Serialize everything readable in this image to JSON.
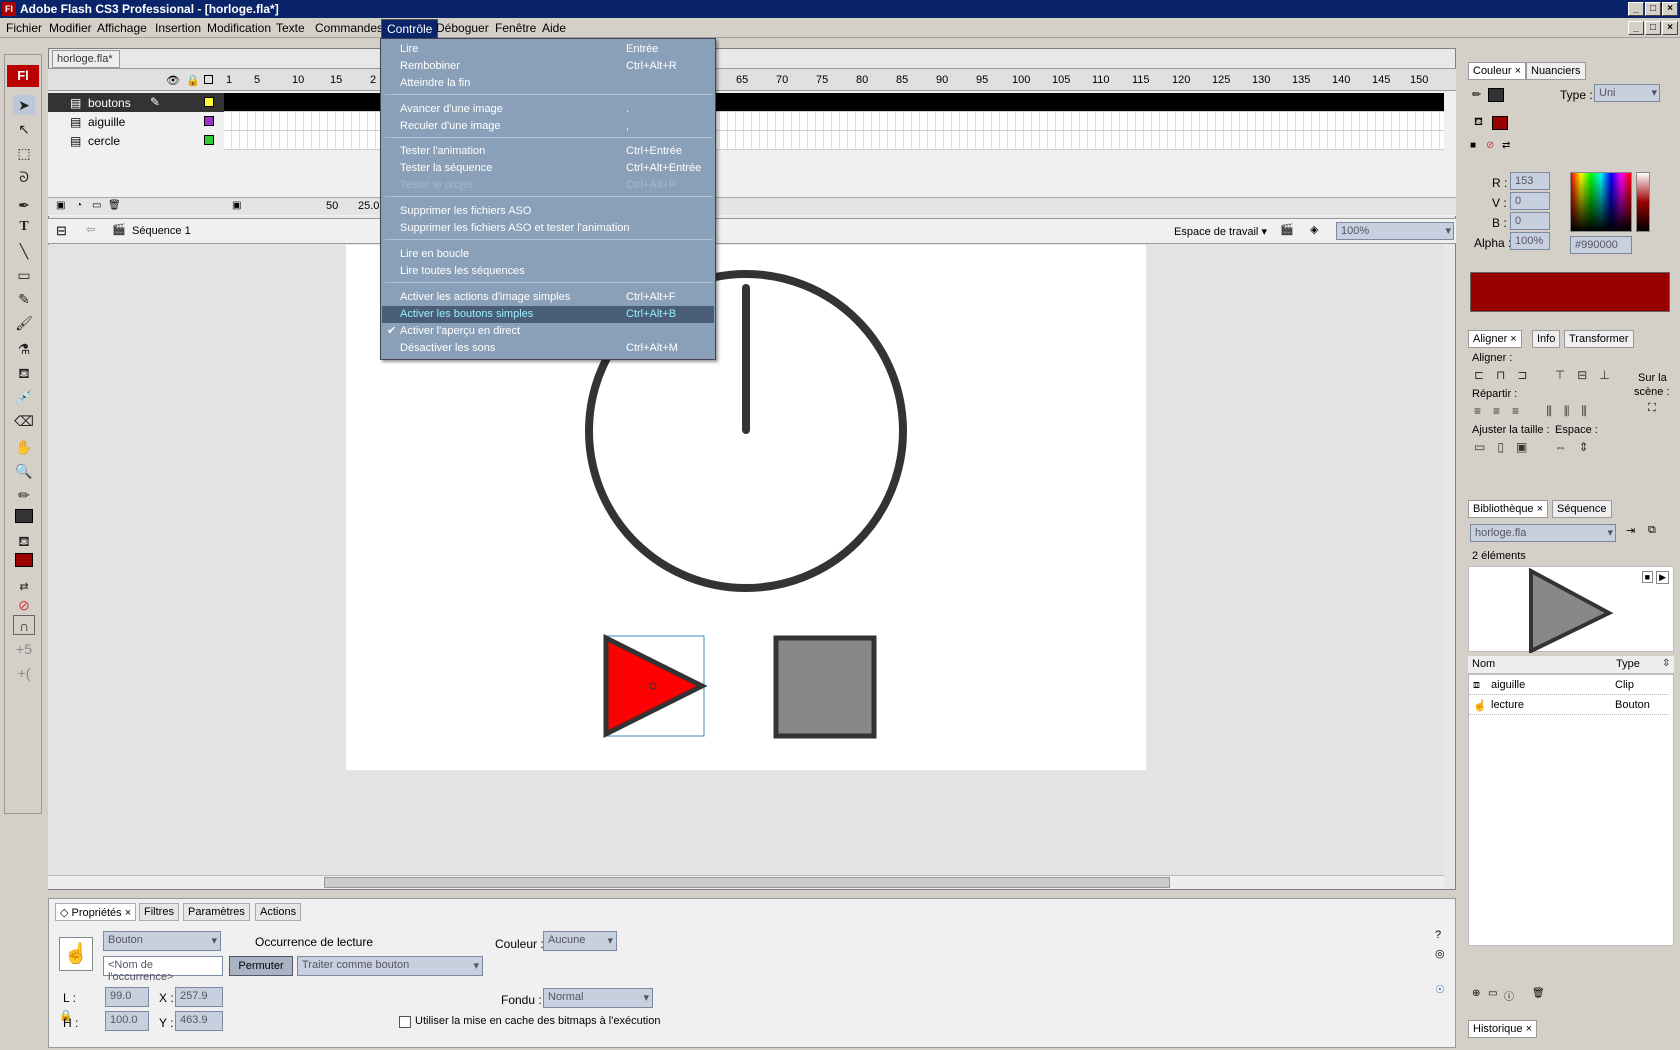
{
  "window": {
    "title": "Adobe Flash CS3 Professional - [horloge.fla*]",
    "logo": "Fl"
  },
  "menubar": [
    "Fichier",
    "Modifier",
    "Affichage",
    "Insertion",
    "Modification",
    "Texte",
    "Commandes",
    "Contrôle",
    "Déboguer",
    "Fenêtre",
    "Aide"
  ],
  "doc": {
    "tab": "horloge.fla*",
    "scene": "Séquence 1",
    "workspace": "Espace de travail",
    "zoom": "100%"
  },
  "timeline": {
    "ruler": [
      "1",
      "5",
      "10",
      "15",
      "2",
      "65",
      "70",
      "75",
      "80",
      "85",
      "90",
      "95",
      "100",
      "105",
      "110",
      "115",
      "120",
      "125",
      "130",
      "135",
      "140",
      "145",
      "150"
    ],
    "layers": [
      {
        "name": "boutons",
        "color": "#ffff33"
      },
      {
        "name": "aiguille",
        "color": "#9933cc"
      },
      {
        "name": "cercle",
        "color": "#33cc33"
      }
    ],
    "fps": "25.0",
    "frame": "50"
  },
  "menu": {
    "items": [
      {
        "label": "Lire",
        "shortcut": "Entrée"
      },
      {
        "label": "Rembobiner",
        "shortcut": "Ctrl+Alt+R"
      },
      {
        "label": "Atteindre la fin",
        "shortcut": ""
      },
      {
        "label": "Avancer d'une image",
        "shortcut": "."
      },
      {
        "label": "Reculer d'une image",
        "shortcut": ","
      },
      {
        "label": "Tester l'animation",
        "shortcut": "Ctrl+Entrée"
      },
      {
        "label": "Tester la séquence",
        "shortcut": "Ctrl+Alt+Entrée"
      },
      {
        "label": "Tester le projet",
        "shortcut": "Ctrl+Alt+P"
      },
      {
        "label": "Supprimer les fichiers ASO",
        "shortcut": ""
      },
      {
        "label": "Supprimer les fichiers ASO et tester l'animation",
        "shortcut": ""
      },
      {
        "label": "Lire en boucle",
        "shortcut": ""
      },
      {
        "label": "Lire toutes les séquences",
        "shortcut": ""
      },
      {
        "label": "Activer les actions d'image simples",
        "shortcut": "Ctrl+Alt+F"
      },
      {
        "label": "Activer les boutons simples",
        "shortcut": "Ctrl+Alt+B"
      },
      {
        "label": "Activer l'aperçu en direct",
        "shortcut": ""
      },
      {
        "label": "Désactiver les sons",
        "shortcut": "Ctrl+Alt+M"
      }
    ],
    "highlighted": "Activer les boutons simples",
    "checked": "Activer l'aperçu en direct",
    "disabled": "Tester le projet"
  },
  "props": {
    "tabs": [
      "Propriétés",
      "Filtres",
      "Paramètres",
      "Actions"
    ],
    "type": "Bouton",
    "instance_placeholder": "<Nom de l'occurrence>",
    "occurrence_label": "Occurrence de :",
    "occurrence_value": "lecture",
    "swap": "Permuter",
    "treat": "Traiter comme bouton",
    "color_label": "Couleur :",
    "color_value": "Aucune",
    "blend_label": "Fondu :",
    "blend_value": "Normal",
    "cache": "Utiliser la mise en cache des bitmaps à l'exécution",
    "L": "99.0",
    "H": "100.0",
    "X": "257.9",
    "Y": "463.9"
  },
  "color_panel": {
    "tabs": [
      "Couleur",
      "Nuanciers"
    ],
    "type_label": "Type :",
    "type_value": "Uni",
    "R": "153",
    "V": "0",
    "B": "0",
    "alpha": "100%",
    "hex": "#990000",
    "swatch": "#990000"
  },
  "align_panel": {
    "tabs": [
      "Aligner",
      "Info",
      "Transformer"
    ],
    "align": "Aligner :",
    "distribute": "Répartir :",
    "size": "Ajuster la taille :",
    "space": "Espace :",
    "stage1": "Sur la",
    "stage2": "scène :"
  },
  "library": {
    "tabs": [
      "Bibliothèque",
      "Séquence"
    ],
    "file": "horloge.fla",
    "count": "2 éléments",
    "col_name": "Nom",
    "col_type": "Type",
    "items": [
      {
        "name": "aiguille",
        "type": "Clip"
      },
      {
        "name": "lecture",
        "type": "Bouton"
      }
    ]
  },
  "history": {
    "tab": "Historique"
  }
}
